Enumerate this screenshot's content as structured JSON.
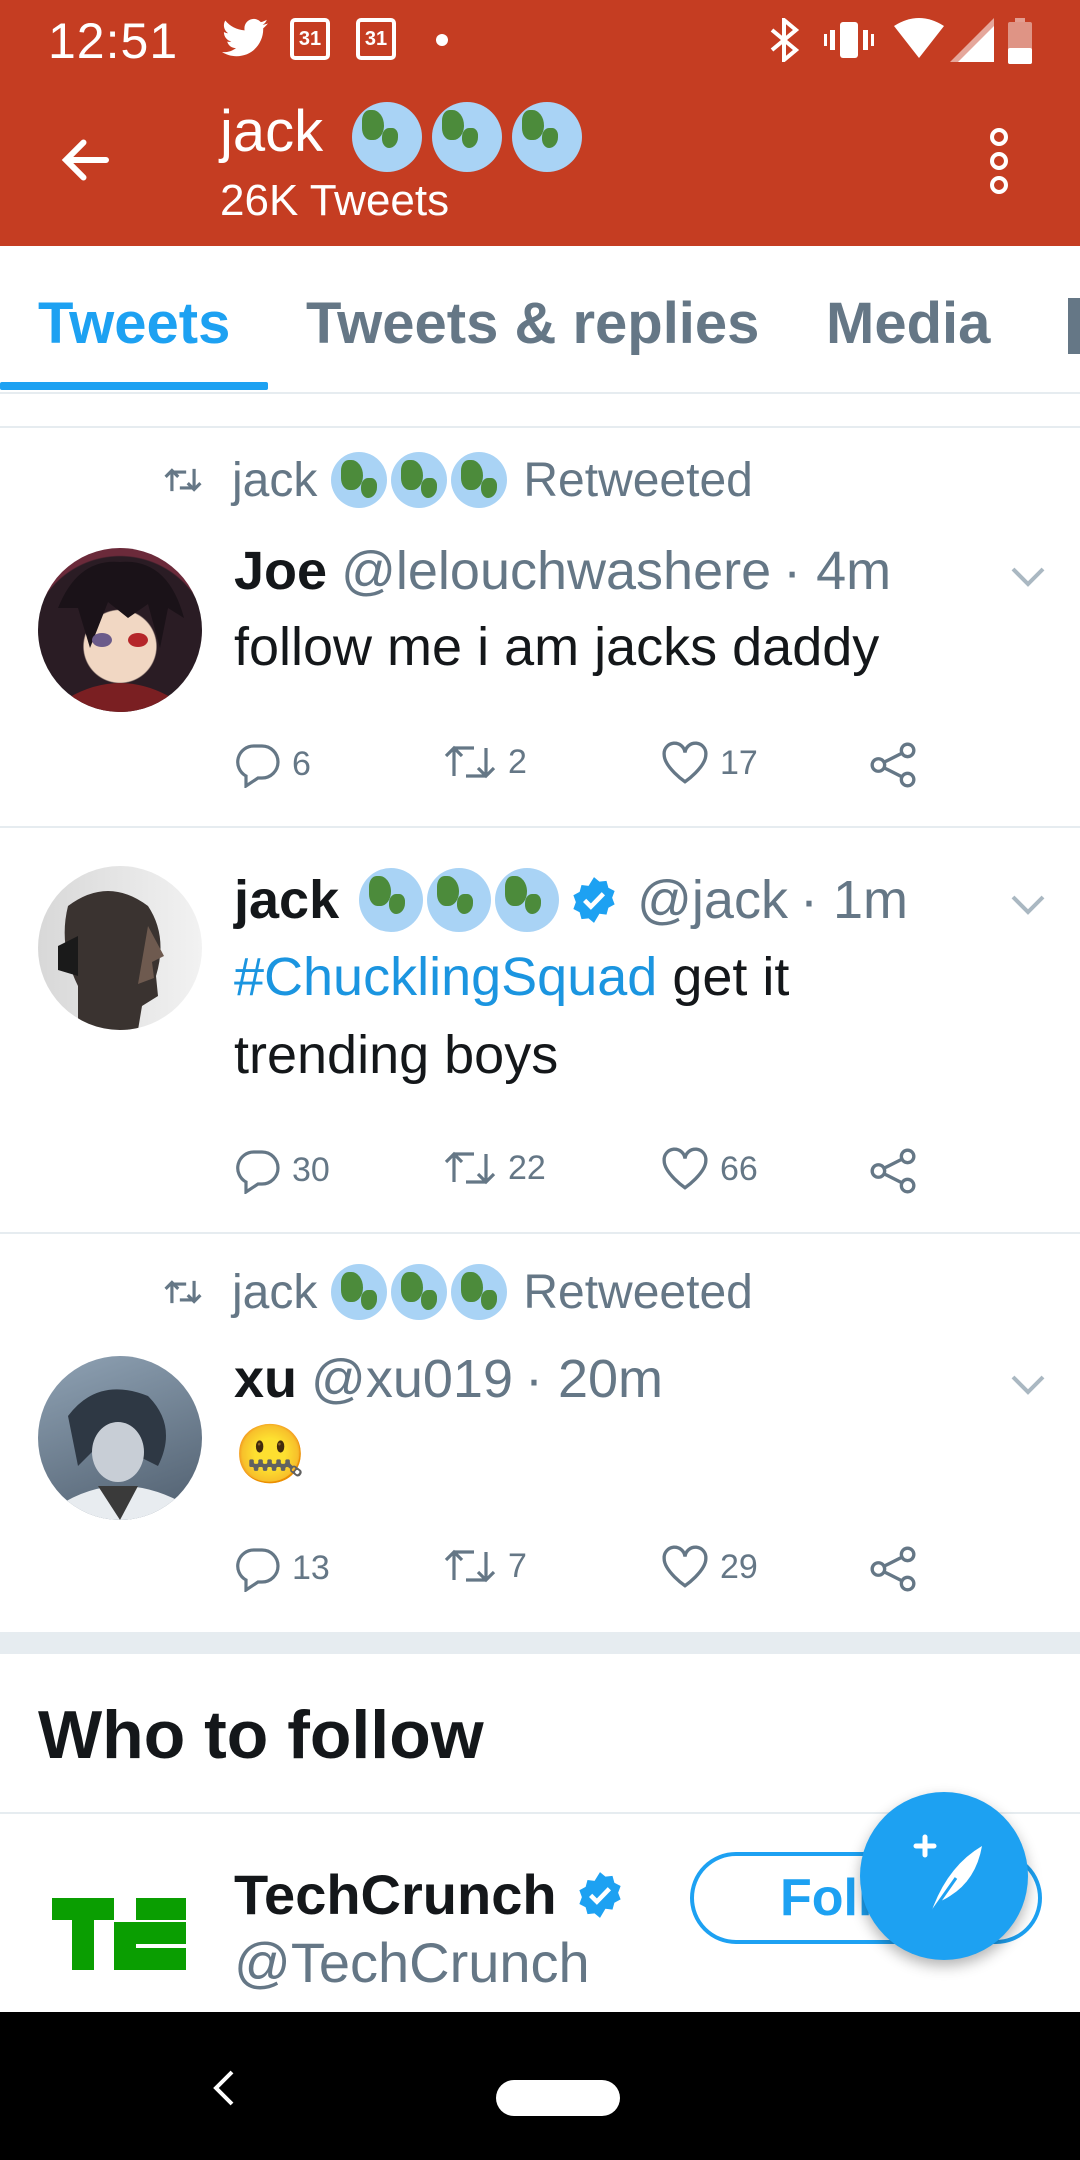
{
  "status_bar": {
    "time": "12:51",
    "calendar_day_1": "31",
    "calendar_day_2": "31"
  },
  "header": {
    "title": "jack",
    "subtitle": "26K Tweets"
  },
  "tabs": [
    {
      "label": "Tweets",
      "active": true
    },
    {
      "label": "Tweets & replies",
      "active": false
    },
    {
      "label": "Media",
      "active": false
    }
  ],
  "tweets": [
    {
      "retweeted_by": "jack",
      "retweeted_label": "Retweeted",
      "name": "Joe",
      "handle": "@lelouchwashere",
      "time": "· 4m",
      "text": "follow me i am jacks daddy",
      "replies": "6",
      "retweets": "2",
      "likes": "17"
    },
    {
      "name": "jack",
      "verified": true,
      "handle": "@jack",
      "time": "· 1m",
      "hashtag": "#ChucklingSquad",
      "text": " get it trending boys",
      "replies": "30",
      "retweets": "22",
      "likes": "66"
    },
    {
      "retweeted_by": "jack",
      "retweeted_label": "Retweeted",
      "name": "xu",
      "handle": "@xu019",
      "time": "· 20m",
      "text": "🤐",
      "replies": "13",
      "retweets": "7",
      "likes": "29"
    }
  ],
  "who_to_follow": {
    "title": "Who to follow",
    "account": {
      "name": "TechCrunch",
      "handle": "@TechCrunch",
      "follow_label": "Follow"
    }
  },
  "colors": {
    "header_bg": "#c53d22",
    "accent": "#1da1f2",
    "techcrunch_green": "#0a9e01"
  }
}
